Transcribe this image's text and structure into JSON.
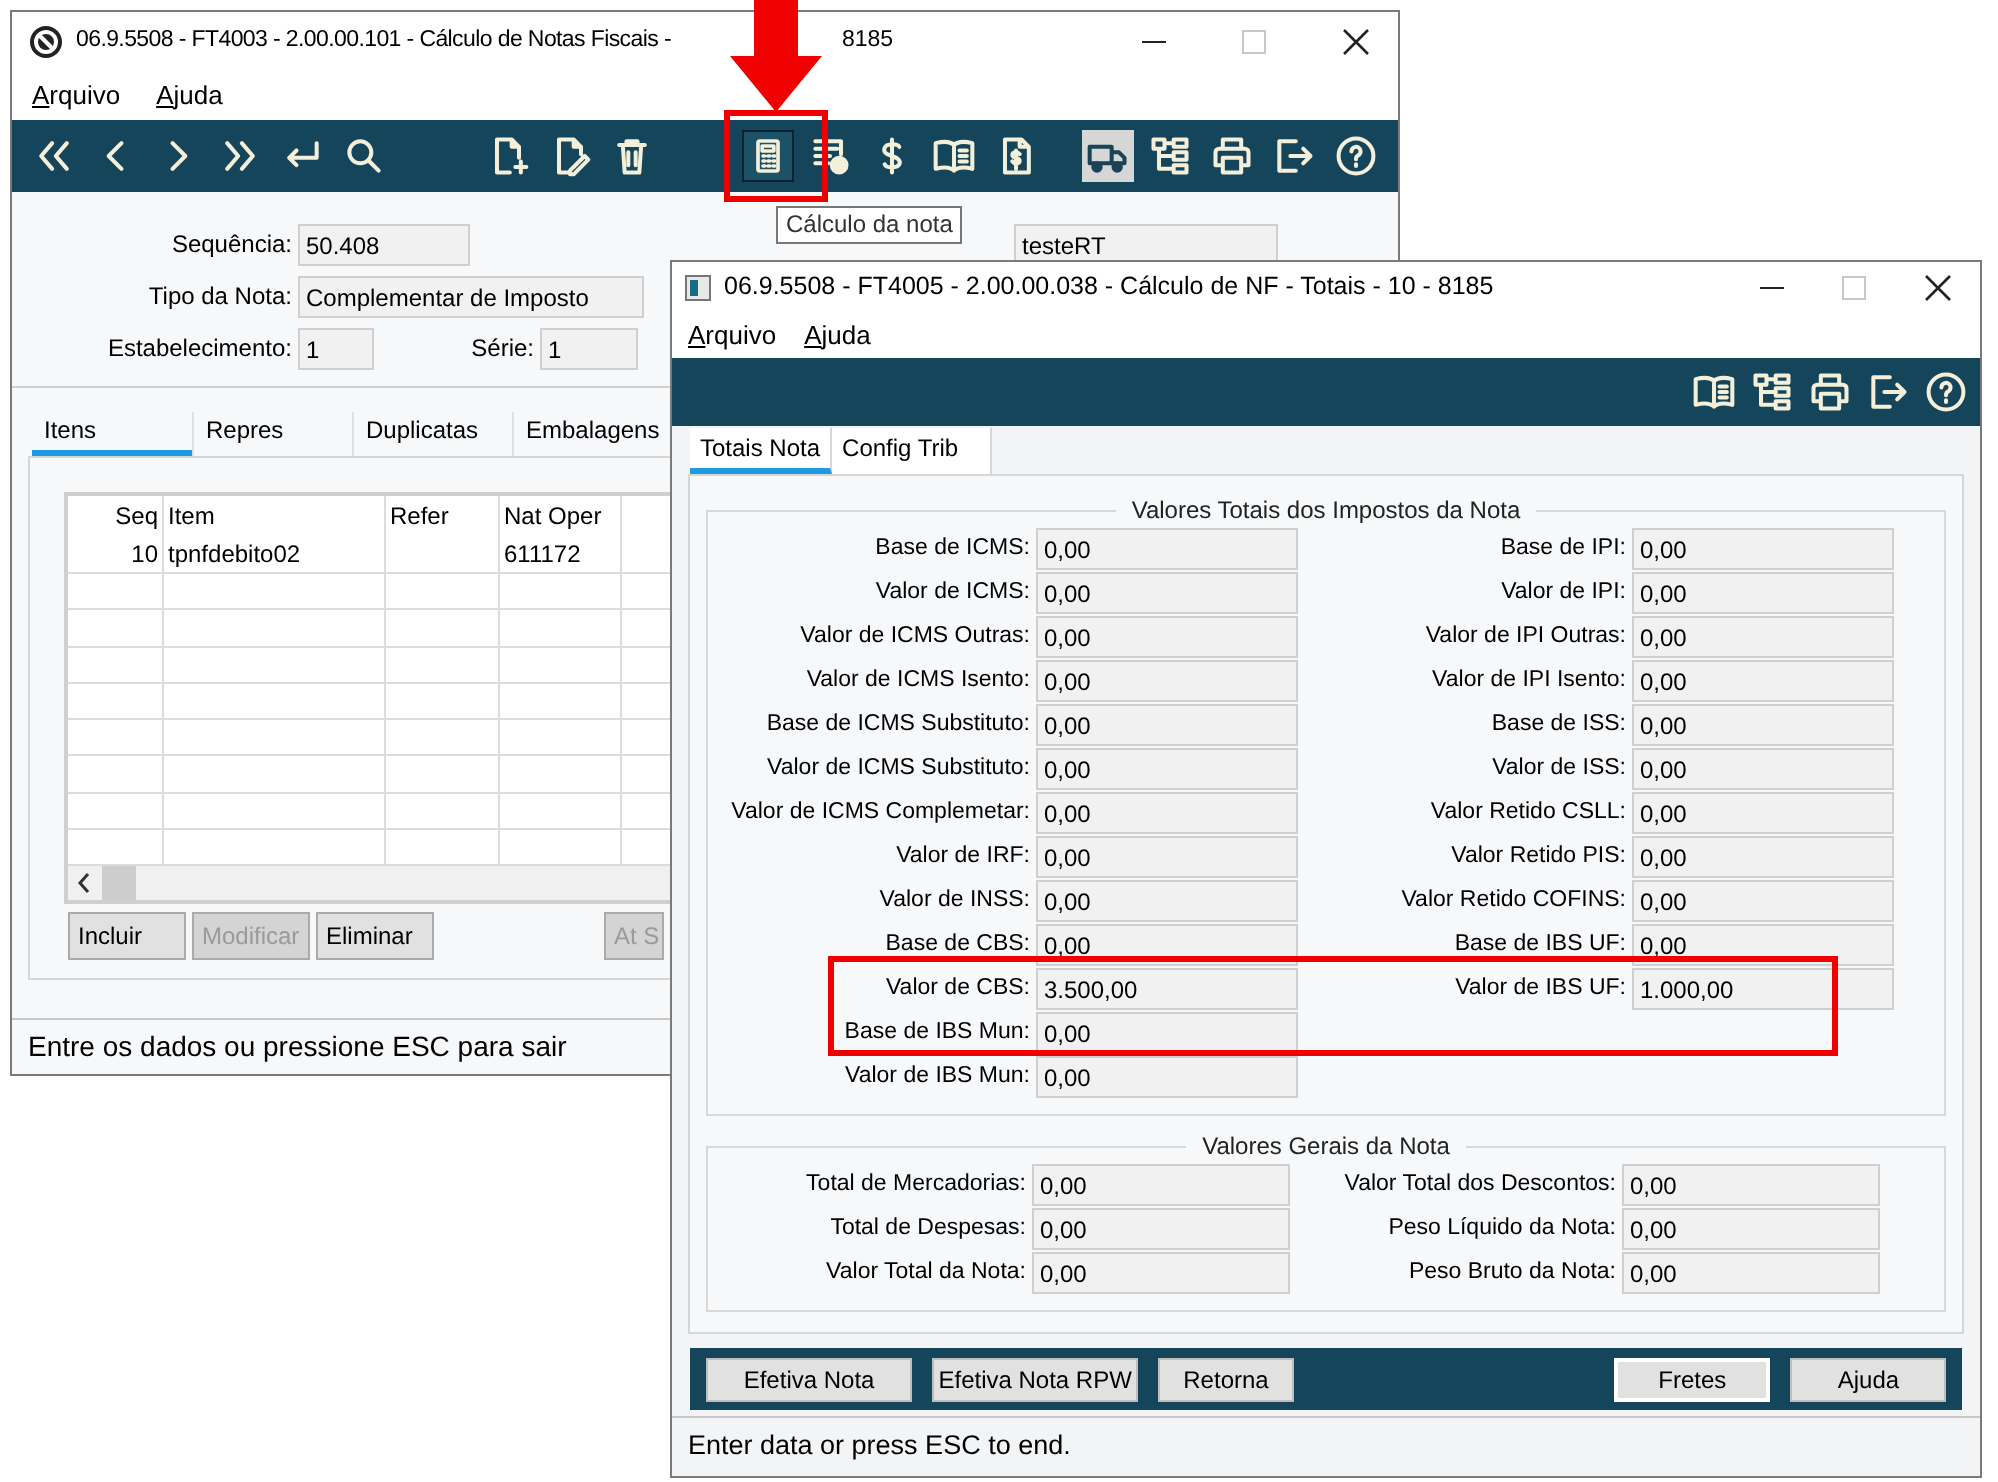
{
  "back_window": {
    "title": "06.9.5508 - FT4003 - 2.00.00.101 - Cálculo de Notas Fiscais -",
    "title_tail": "8185",
    "menu": [
      "Arquivo",
      "Ajuda"
    ],
    "toolbar": [
      [
        {
          "kind": "first",
          "hovered": false,
          "pressed": false
        },
        {
          "kind": "prev",
          "hovered": false,
          "pressed": false
        },
        {
          "kind": "next",
          "hovered": false,
          "pressed": false
        },
        {
          "kind": "last",
          "hovered": false,
          "pressed": false
        },
        {
          "kind": "enter",
          "hovered": false,
          "pressed": false
        },
        {
          "kind": "search",
          "hovered": false,
          "pressed": false
        }
      ],
      [
        {
          "kind": "new",
          "hovered": false,
          "pressed": false
        },
        {
          "kind": "edit",
          "hovered": false,
          "pressed": false
        },
        {
          "kind": "delete",
          "hovered": false,
          "pressed": false
        }
      ],
      [
        {
          "kind": "calculator",
          "hovered": true,
          "pressed": false
        },
        {
          "kind": "checklist",
          "hovered": false,
          "pressed": false
        },
        {
          "kind": "dollar",
          "hovered": false,
          "pressed": false
        },
        {
          "kind": "book",
          "hovered": false,
          "pressed": false
        },
        {
          "kind": "invoice",
          "hovered": false,
          "pressed": false
        }
      ],
      [
        {
          "kind": "truck",
          "hovered": false,
          "pressed": true
        },
        {
          "kind": "tree",
          "hovered": false,
          "pressed": false
        },
        {
          "kind": "print",
          "hovered": false,
          "pressed": false
        },
        {
          "kind": "exit",
          "hovered": false,
          "pressed": false
        },
        {
          "kind": "help",
          "hovered": false,
          "pressed": false
        }
      ]
    ],
    "tooltip": "Cálculo da nota",
    "sequencia": {
      "label": "Sequência:",
      "value": "50.408"
    },
    "cliente": {
      "value": "testeRT"
    },
    "tipo": {
      "label": "Tipo da Nota:",
      "value": "Complementar de Imposto"
    },
    "estabelecimento": {
      "label": "Estabelecimento:",
      "value": "1"
    },
    "serie": {
      "label": "Série:",
      "value": "1"
    },
    "tabs": [
      {
        "label": "Itens",
        "selected": true
      },
      {
        "label": "Repres",
        "selected": false
      },
      {
        "label": "Duplicatas",
        "selected": false
      },
      {
        "label": "Embalagens",
        "selected": false
      }
    ],
    "grid": {
      "columns": [
        "Seq",
        "Item",
        "Refer",
        "Nat Oper"
      ],
      "rows": [
        {
          "seq": "10",
          "item": "tpnfdebito02",
          "nat_oper": "611172"
        }
      ]
    },
    "buttons": [
      {
        "label": "Incluir",
        "disabled": false
      },
      {
        "label": "Modificar",
        "disabled": true
      },
      {
        "label": "Eliminar",
        "disabled": false
      },
      {
        "label": "At S",
        "disabled": true
      }
    ],
    "status": "Entre os dados ou pressione ESC para sair"
  },
  "front_window": {
    "title": "06.9.5508 - FT4005 - 2.00.00.038 - Cálculo de NF - Totais - 10 - 8185",
    "menu": [
      "Arquivo",
      "Ajuda"
    ],
    "toolbar": [
      {
        "kind": "book",
        "hovered": false,
        "pressed": false
      },
      {
        "kind": "tree",
        "hovered": false,
        "pressed": false
      },
      {
        "kind": "print",
        "hovered": false,
        "pressed": false
      },
      {
        "kind": "exit",
        "hovered": false,
        "pressed": false
      },
      {
        "kind": "help",
        "hovered": false,
        "pressed": false
      }
    ],
    "tabs": [
      {
        "label": "Totais Nota",
        "selected": true
      },
      {
        "label": "Config Trib",
        "selected": false
      }
    ],
    "tax_group": {
      "title": "Valores Totais dos Impostos da Nota",
      "left": [
        {
          "label": "Base de ICMS:",
          "value": "0,00"
        },
        {
          "label": "Valor de ICMS:",
          "value": "0,00"
        },
        {
          "label": "Valor de ICMS Outras:",
          "value": "0,00"
        },
        {
          "label": "Valor de ICMS Isento:",
          "value": "0,00"
        },
        {
          "label": "Base de ICMS Substituto:",
          "value": "0,00"
        },
        {
          "label": "Valor de ICMS Substituto:",
          "value": "0,00"
        },
        {
          "label": "Valor de ICMS Complemetar:",
          "value": "0,00"
        },
        {
          "label": "Valor de IRF:",
          "value": "0,00"
        },
        {
          "label": "Valor de INSS:",
          "value": "0,00"
        },
        {
          "label": "Base de CBS:",
          "value": "0,00"
        },
        {
          "label": "Valor de CBS:",
          "value": "3.500,00"
        },
        {
          "label": "Base de IBS Mun:",
          "value": "0,00"
        },
        {
          "label": "Valor de IBS Mun:",
          "value": "0,00"
        }
      ],
      "right": [
        {
          "label": "Base de IPI:",
          "value": "0,00"
        },
        {
          "label": "Valor de IPI:",
          "value": "0,00"
        },
        {
          "label": "Valor de IPI Outras:",
          "value": "0,00"
        },
        {
          "label": "Valor de IPI Isento:",
          "value": "0,00"
        },
        {
          "label": "Base de ISS:",
          "value": "0,00"
        },
        {
          "label": "Valor de ISS:",
          "value": "0,00"
        },
        {
          "label": "Valor Retido CSLL:",
          "value": "0,00"
        },
        {
          "label": "Valor Retido PIS:",
          "value": "0,00"
        },
        {
          "label": "Valor Retido COFINS:",
          "value": "0,00"
        },
        {
          "label": "Base de IBS UF:",
          "value": "0,00"
        },
        {
          "label": "Valor de IBS UF:",
          "value": "1.000,00"
        }
      ]
    },
    "general_group": {
      "title": "Valores Gerais da Nota",
      "left": [
        {
          "label": "Total de Mercadorias:",
          "value": "0,00"
        },
        {
          "label": "Total de Despesas:",
          "value": "0,00"
        },
        {
          "label": "Valor Total da Nota:",
          "value": "0,00"
        }
      ],
      "right": [
        {
          "label": "Valor Total dos Descontos:",
          "value": "0,00"
        },
        {
          "label": "Peso Líquido da Nota:",
          "value": "0,00"
        },
        {
          "label": "Peso Bruto da Nota:",
          "value": "0,00"
        }
      ]
    },
    "buttons": [
      {
        "label": "Efetiva Nota",
        "focused": false
      },
      {
        "label": "Efetiva Nota RPW",
        "focused": false
      },
      {
        "label": "Retorna",
        "focused": false
      },
      {
        "label": "Fretes",
        "focused": true
      },
      {
        "label": "Ajuda",
        "focused": false
      }
    ],
    "status": "Enter data or press ESC to end."
  }
}
